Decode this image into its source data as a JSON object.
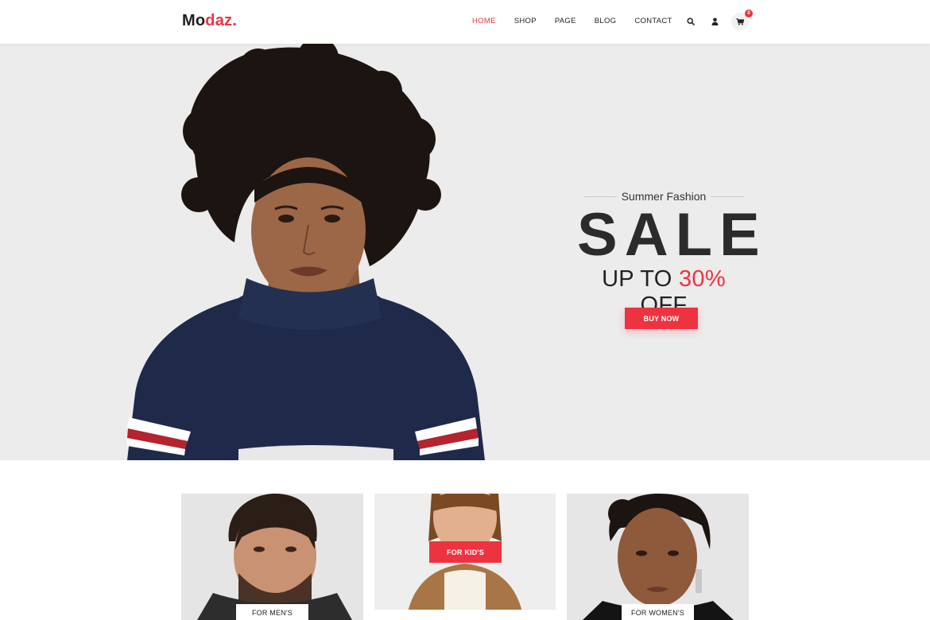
{
  "brand": {
    "part1": "Mo",
    "part2": "daz."
  },
  "nav": {
    "items": [
      "HOME",
      "SHOP",
      "PAGE",
      "BLOG",
      "CONTACT"
    ],
    "active_index": 0
  },
  "header_icons": {
    "search": "search-icon",
    "user": "user-icon",
    "cart": "cart-icon",
    "cart_count": "0"
  },
  "hero": {
    "kicker": "Summer Fashion",
    "headline": "SALE",
    "offer_prefix": "UP TO ",
    "offer_value": "30%",
    "offer_suffix": " OFF",
    "cta": "BUY NOW"
  },
  "categories": [
    {
      "label": "FOR MEN'S"
    },
    {
      "label": "FOR KID'S"
    },
    {
      "label": "FOR WOMEN'S"
    }
  ],
  "colors": {
    "accent": "#ee3340",
    "hero_bg": "#ececec",
    "text": "#222222"
  }
}
